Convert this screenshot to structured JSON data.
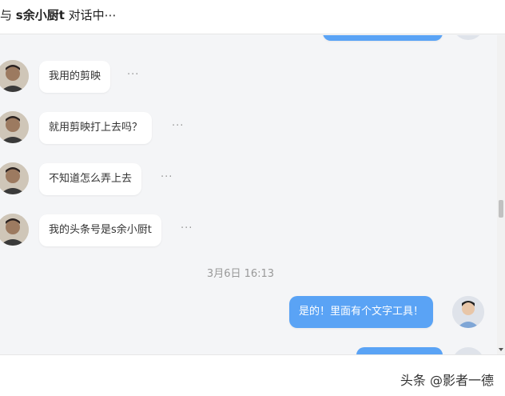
{
  "header": {
    "prefix": "与 ",
    "contact": "s余小厨t",
    "suffix": " 对话中⋯"
  },
  "messages": [
    {
      "text": "我用的剪映",
      "more": "···"
    },
    {
      "text": "就用剪映打上去吗？",
      "more": "···"
    },
    {
      "text": "不知道怎么弄上去",
      "more": "···"
    },
    {
      "text": "我的头条号是s余小厨t",
      "more": "···"
    },
    {
      "text": "是的！里面有个文字工具！"
    }
  ],
  "timestamp": "3月6日 16:13",
  "watermark": "头条 @影者一德",
  "colors": {
    "outgoing_bubble": "#5aa3f5",
    "background": "#f4f5f7"
  }
}
